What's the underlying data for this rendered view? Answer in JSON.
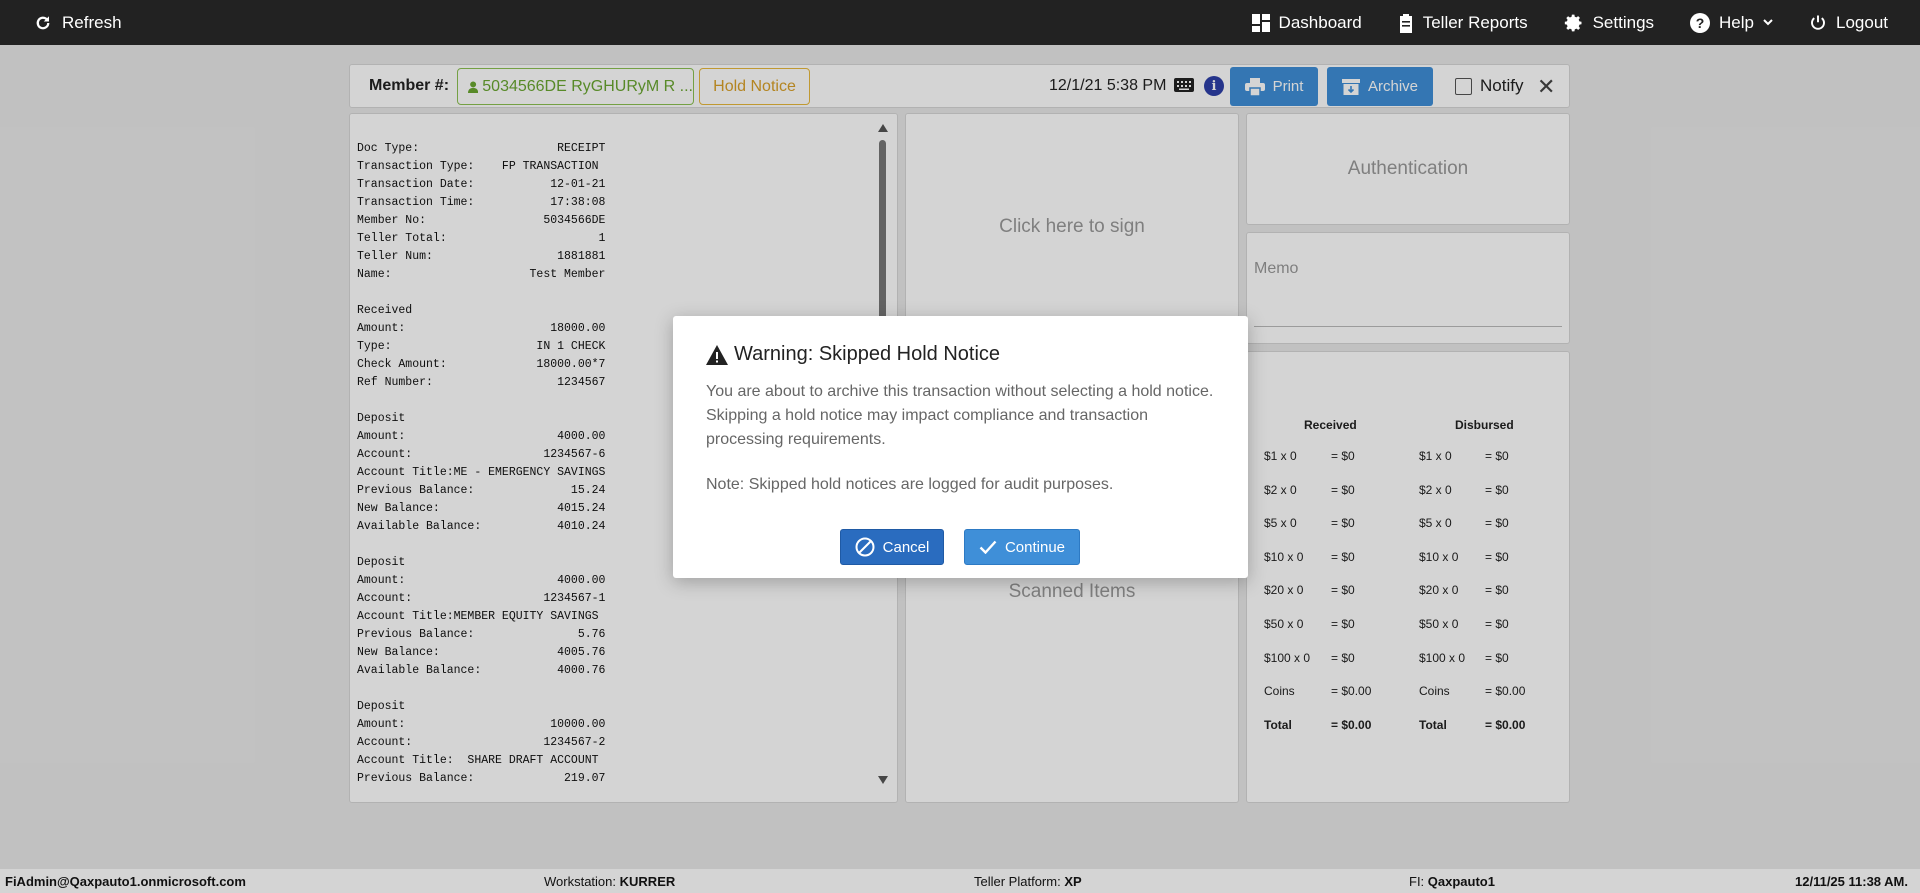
{
  "topnav": {
    "refresh": "Refresh",
    "dashboard": "Dashboard",
    "teller_reports": "Teller Reports",
    "settings": "Settings",
    "help": "Help",
    "logout": "Logout"
  },
  "header": {
    "member_label": "Member #:",
    "member_value": "5034566DE RyGHURyM R ...",
    "hold_notice": "Hold Notice",
    "datetime": "12/1/21 5:38 PM",
    "print": "Print",
    "archive": "Archive",
    "notify": "Notify",
    "close": "✕"
  },
  "receipt": {
    "text": "Doc Type:                    RECEIPT\nTransaction Type:    FP TRANSACTION\nTransaction Date:           12-01-21\nTransaction Time:           17:38:08\nMember No:                 5034566DE\nTeller Total:                      1\nTeller Num:                  1881881\nName:                    Test Member\n\nReceived\nAmount:                     18000.00\nType:                     IN 1 CHECK\nCheck Amount:             18000.00*7\nRef Number:                  1234567\n\nDeposit\nAmount:                      4000.00\nAccount:                   1234567-6\nAccount Title:ME - EMERGENCY SAVINGS\nPrevious Balance:              15.24\nNew Balance:                 4015.24\nAvailable Balance:           4010.24\n\nDeposit\nAmount:                      4000.00\nAccount:                   1234567-1\nAccount Title:MEMBER EQUITY SAVINGS\nPrevious Balance:               5.76\nNew Balance:                 4005.76\nAvailable Balance:           4000.76\n\nDeposit\nAmount:                     10000.00\nAccount:                   1234567-2\nAccount Title:  SHARE DRAFT ACCOUNT\nPrevious Balance:             219.07"
  },
  "sign": {
    "click_to_sign": "Click here to sign",
    "scanned_items": "Scanned Items"
  },
  "auth": {
    "label": "Authentication"
  },
  "memo": {
    "label": "Memo"
  },
  "cash": {
    "received_header": "Received",
    "disbursed_header": "Disbursed",
    "received": [
      {
        "label": "$1 x 0",
        "value": "= $0"
      },
      {
        "label": "$2 x 0",
        "value": "= $0"
      },
      {
        "label": "$5 x 0",
        "value": "= $0"
      },
      {
        "label": "$10 x 0",
        "value": "= $0"
      },
      {
        "label": "$20 x 0",
        "value": "= $0"
      },
      {
        "label": "$50 x 0",
        "value": "= $0"
      },
      {
        "label": "$100 x 0",
        "value": "= $0"
      },
      {
        "label": "Coins",
        "value": "= $0.00"
      },
      {
        "label": "Total",
        "value": "= $0.00"
      }
    ],
    "disbursed": [
      {
        "label": "$1 x 0",
        "value": "= $0"
      },
      {
        "label": "$2 x 0",
        "value": "= $0"
      },
      {
        "label": "$5 x 0",
        "value": "= $0"
      },
      {
        "label": "$10 x 0",
        "value": "= $0"
      },
      {
        "label": "$20 x 0",
        "value": "= $0"
      },
      {
        "label": "$50 x 0",
        "value": "= $0"
      },
      {
        "label": "$100 x 0",
        "value": "= $0"
      },
      {
        "label": "Coins",
        "value": "= $0.00"
      },
      {
        "label": "Total",
        "value": "= $0.00"
      }
    ]
  },
  "modal": {
    "title": "Warning: Skipped Hold Notice",
    "body": "You are about to archive this transaction without selecting a hold notice. Skipping a hold notice may impact compliance and transaction processing requirements.",
    "note": "Note: Skipped hold notices are logged for audit purposes.",
    "cancel": "Cancel",
    "continue": "Continue"
  },
  "statusbar": {
    "user": "FiAdmin@Qaxpauto1.onmicrosoft.com",
    "workstation_label": "Workstation:",
    "workstation_value": "KURRER",
    "platform_label": "Teller Platform:",
    "platform_value": "XP",
    "fi_label": "FI:",
    "fi_value": "Qaxpauto1",
    "datetime": "12/11/25 11:38 AM."
  },
  "colors": {
    "nav_bg": "#222222",
    "primary_button": "#3f8fd8",
    "member_green": "#6aa631",
    "hold_yellow": "#d9a028",
    "info_blue": "#2d3fa8"
  }
}
